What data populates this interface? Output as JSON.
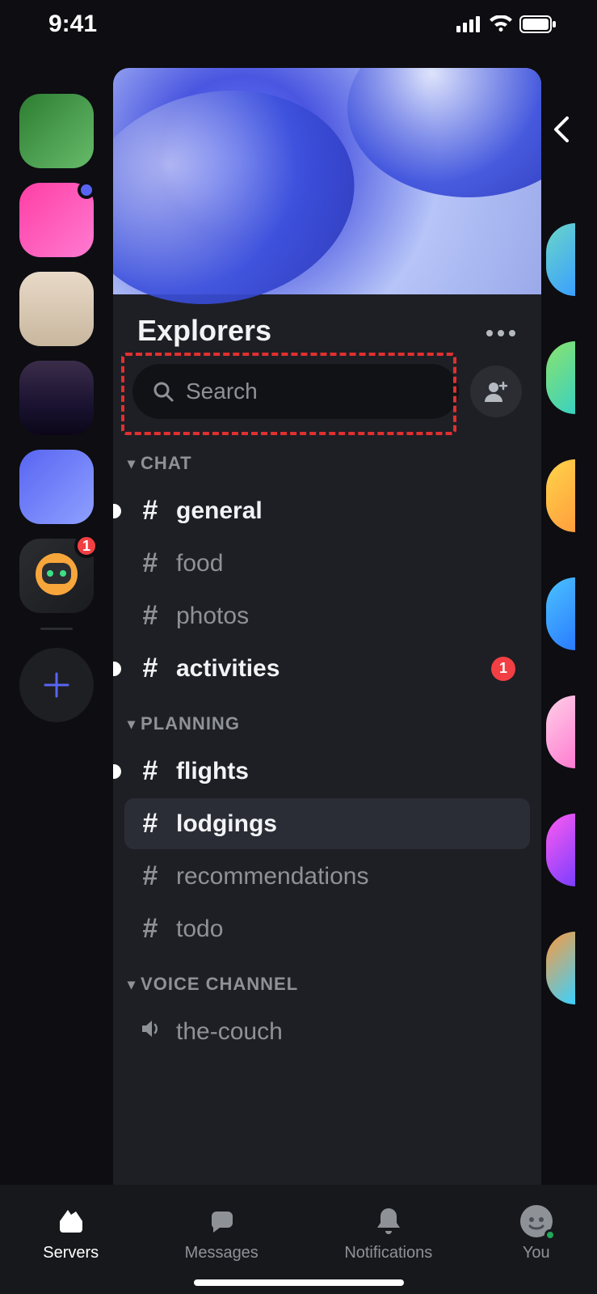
{
  "status": {
    "time": "9:41"
  },
  "server": {
    "name": "Explorers",
    "search_placeholder": "Search"
  },
  "server_list": [
    {
      "id": "plants",
      "badge": null,
      "notification_dot": false
    },
    {
      "id": "frog",
      "badge": null,
      "notification_dot": true
    },
    {
      "id": "cat",
      "badge": null,
      "notification_dot": false
    },
    {
      "id": "sunset",
      "badge": null,
      "notification_dot": false
    },
    {
      "id": "blob",
      "badge": null,
      "notification_dot": false
    },
    {
      "id": "robot",
      "badge": "1",
      "notification_dot": false
    }
  ],
  "categories": [
    {
      "name": "CHAT",
      "channels": [
        {
          "name": "general",
          "type": "text",
          "unread": true,
          "selected": false,
          "mention_count": null
        },
        {
          "name": "food",
          "type": "text",
          "unread": false,
          "selected": false,
          "mention_count": null
        },
        {
          "name": "photos",
          "type": "text",
          "unread": false,
          "selected": false,
          "mention_count": null
        },
        {
          "name": "activities",
          "type": "text",
          "unread": true,
          "selected": false,
          "mention_count": "1"
        }
      ]
    },
    {
      "name": "PLANNING",
      "channels": [
        {
          "name": "flights",
          "type": "text",
          "unread": true,
          "selected": false,
          "mention_count": null
        },
        {
          "name": "lodgings",
          "type": "text",
          "unread": false,
          "selected": true,
          "mention_count": null
        },
        {
          "name": "recommendations",
          "type": "text",
          "unread": false,
          "selected": false,
          "mention_count": null
        },
        {
          "name": "todo",
          "type": "text",
          "unread": false,
          "selected": false,
          "mention_count": null
        }
      ]
    },
    {
      "name": "VOICE CHANNEL",
      "channels": [
        {
          "name": "the-couch",
          "type": "voice",
          "unread": false,
          "selected": false,
          "mention_count": null
        }
      ]
    }
  ],
  "bottom_nav": {
    "servers": "Servers",
    "messages": "Messages",
    "notifications": "Notifications",
    "you": "You"
  }
}
